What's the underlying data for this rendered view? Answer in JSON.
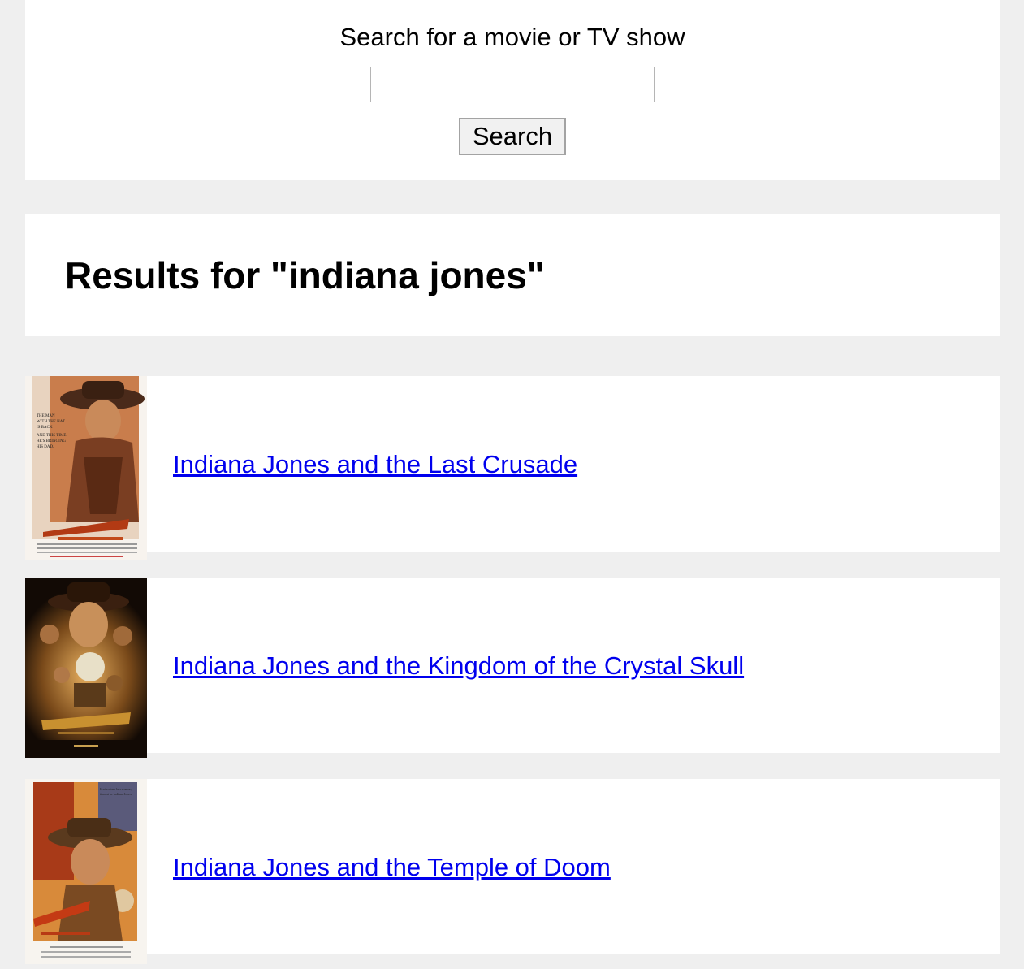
{
  "search": {
    "label": "Search for a movie or TV show",
    "input_value": "",
    "placeholder": "",
    "button_label": "Search"
  },
  "results": {
    "heading": "Results for \"indiana jones\"",
    "items": [
      {
        "title": "Indiana Jones and the Last Crusade",
        "poster_icon": "last-crusade-poster"
      },
      {
        "title": "Indiana Jones and the Kingdom of the Crystal Skull",
        "poster_icon": "crystal-skull-poster"
      },
      {
        "title": "Indiana Jones and the Temple of Doom",
        "poster_icon": "temple-of-doom-poster"
      }
    ]
  },
  "colors": {
    "page_background": "#efefef",
    "panel_background": "#ffffff",
    "link": "#0000ee"
  }
}
